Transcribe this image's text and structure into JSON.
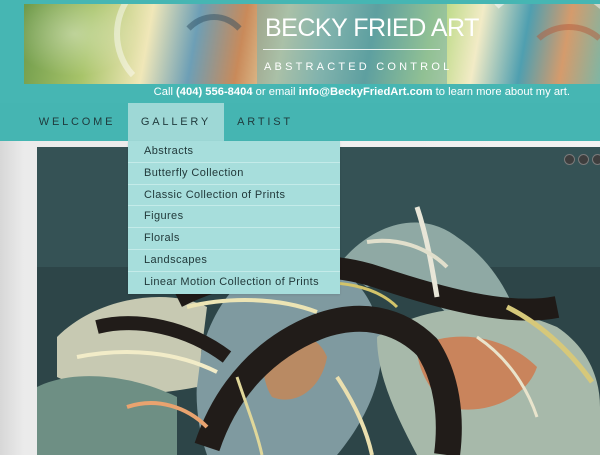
{
  "header": {
    "logo_title": "BECKY FRIED ART",
    "logo_subtitle": "ABSTRACTED CONTROL",
    "contact": {
      "prefix": "Call ",
      "phone": "(404) 556-8404",
      "middle": " or email ",
      "email": "info@BeckyFriedArt.com",
      "suffix": " to learn more about my art."
    }
  },
  "nav": {
    "items": [
      {
        "label": "WELCOME"
      },
      {
        "label": "GALLERY",
        "active": true
      },
      {
        "label": "ARTIST"
      }
    ]
  },
  "gallery_menu": {
    "items": [
      {
        "label": "Abstracts"
      },
      {
        "label": "Butterfly Collection"
      },
      {
        "label": "Classic Collection of Prints"
      },
      {
        "label": "Figures"
      },
      {
        "label": "Florals"
      },
      {
        "label": "Landscapes"
      },
      {
        "label": "Linear Motion Collection of Prints"
      }
    ]
  },
  "slider": {
    "dot_count": 3
  },
  "colors": {
    "header_bg": "#46b6b3",
    "nav_active": "#9ed8d6",
    "dropdown_bg": "#a7dedc",
    "text_dark": "#1f3a3c"
  }
}
